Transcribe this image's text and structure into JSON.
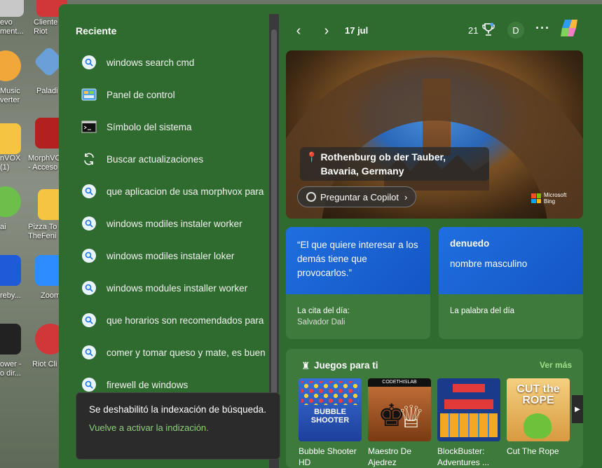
{
  "desktop": {
    "icons": [
      {
        "label": "evo\nment..."
      },
      {
        "label": "Cliente\nRiot"
      },
      {
        "label": "Music\nverter"
      },
      {
        "label": "Paladi"
      },
      {
        "label": "nVOX\n(1)"
      },
      {
        "label": "MorphVO\n- Acceso"
      },
      {
        "label": "ai"
      },
      {
        "label": "Pizza To\nTheFeni"
      },
      {
        "label": "reby..."
      },
      {
        "label": "Zoom"
      },
      {
        "label": "ower -\no dir..."
      },
      {
        "label": "Riot Cli"
      }
    ]
  },
  "search": {
    "section_title": "Reciente",
    "recent": [
      {
        "label": "windows search cmd",
        "icon": "search-icon"
      },
      {
        "label": "Panel de control",
        "icon": "control-panel-icon"
      },
      {
        "label": "Símbolo del sistema",
        "icon": "terminal-icon"
      },
      {
        "label": "Buscar actualizaciones",
        "icon": "refresh-icon"
      },
      {
        "label": "que aplicacion de usa morphvox para",
        "icon": "search-icon"
      },
      {
        "label": "windows modiles instaler worker",
        "icon": "search-icon"
      },
      {
        "label": "windows modiles instaler loker",
        "icon": "search-icon"
      },
      {
        "label": "windows modules installer worker",
        "icon": "search-icon"
      },
      {
        "label": "que horarios son recomendados para",
        "icon": "search-icon"
      },
      {
        "label": "comer y tomar queso y mate, es buen",
        "icon": "search-icon"
      },
      {
        "label": "firewell de windows",
        "icon": "search-icon"
      }
    ],
    "toast": {
      "message": "Se deshabilitó la indexación de búsqueda.",
      "link": "Vuelve a activar la indización."
    }
  },
  "topbar": {
    "prev": "‹",
    "next": "›",
    "date": "17 jul",
    "points": "21",
    "avatar": "D",
    "more": "···"
  },
  "hero": {
    "location_line1": "Rothenburg ob der Tauber,",
    "location_line2": "Bavaria, Germany",
    "ask_label": "Preguntar a Copilot",
    "brand_line1": "Microsoft",
    "brand_line2": "Bing"
  },
  "quote_card": {
    "text": "“El que quiere interesar a los demás tiene que provocarlos.”",
    "footer_title": "La cita del día:",
    "footer_author": "Salvador Dali"
  },
  "word_card": {
    "word": "denuedo",
    "meaning": "nombre masculino",
    "footer_title": "La palabra del día"
  },
  "games": {
    "title": "Juegos para ti",
    "see_more": "Ver más",
    "items": [
      {
        "name": "Bubble Shooter HD",
        "art_title": "BUBBLE SHOOTER"
      },
      {
        "name": "Maestro De Ajedrez",
        "art_title": "CODETHISLAB"
      },
      {
        "name": "BlockBuster: Adventures ...",
        "art_title": ""
      },
      {
        "name": "Cut The Rope",
        "art_title": "CUT the ROPE"
      }
    ]
  },
  "colors": {
    "panel": "#2f6b2e",
    "card": "#3f7a3d",
    "accent_link": "#8fd07a",
    "blue_card": "#1f6fe0"
  }
}
